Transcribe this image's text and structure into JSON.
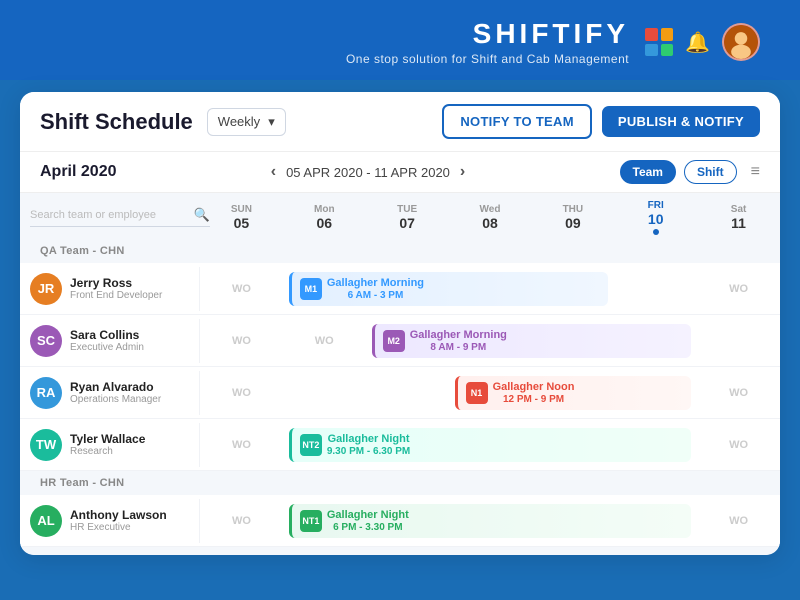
{
  "brand": {
    "title": "SHIFTIFY",
    "subtitle": "One stop solution for Shift and Cab Management"
  },
  "header": {
    "grid_icon": "grid-icon",
    "bell_icon": "🔔",
    "avatar_initials": "👤"
  },
  "schedule": {
    "title": "Shift Schedule",
    "weekly_label": "Weekly",
    "notify_btn": "NOTIFY TO TEAM",
    "publish_btn": "PUBLISH & NOTIFY"
  },
  "nav": {
    "month": "April 2020",
    "date_range": "05 APR  2020 - 11 APR  2020",
    "team_btn": "Team",
    "shift_btn": "Shift",
    "search_placeholder": "Search team or employee"
  },
  "days": [
    {
      "label": "SUN",
      "num": "05",
      "highlight": false
    },
    {
      "label": "Mon",
      "num": "06",
      "highlight": false
    },
    {
      "label": "TUE",
      "num": "07",
      "highlight": false
    },
    {
      "label": "Wed",
      "num": "08",
      "highlight": false
    },
    {
      "label": "THU",
      "num": "09",
      "highlight": false
    },
    {
      "label": "FRI",
      "num": "10",
      "highlight": true
    },
    {
      "label": "Sat",
      "num": "11",
      "highlight": false
    }
  ],
  "teams": [
    {
      "name": "QA Team - CHN",
      "employees": [
        {
          "name": "Jerry Ross",
          "role": "Front End Developer",
          "avatar_color": "#e67e22",
          "initials": "JR",
          "cells": [
            {
              "type": "wo",
              "col": 1
            },
            {
              "type": "shift",
              "col": 2,
              "span": 4,
              "badge": "M1",
              "shift_type": "morning",
              "shift_name": "Gallagher Morning",
              "shift_time": "6 AM - 3 PM"
            },
            {
              "type": "wo",
              "col": 7
            }
          ]
        },
        {
          "name": "Sara Collins",
          "role": "Executive Admin",
          "avatar_color": "#9b59b6",
          "initials": "SC",
          "cells": [
            {
              "type": "wo",
              "col": 1
            },
            {
              "type": "wo",
              "col": 2
            },
            {
              "type": "shift",
              "col": 3,
              "span": 4,
              "badge": "M2",
              "shift_type": "morning2",
              "shift_name": "Gallagher Morning",
              "shift_time": "8 AM - 9 PM"
            }
          ]
        },
        {
          "name": "Ryan Alvarado",
          "role": "Operations Manager",
          "avatar_color": "#3498db",
          "initials": "RA",
          "cells": [
            {
              "type": "wo",
              "col": 1
            },
            {
              "type": "empty",
              "col": 2,
              "span": 2
            },
            {
              "type": "shift",
              "col": 4,
              "span": 3,
              "badge": "N1",
              "shift_type": "noon",
              "shift_name": "Gallagher Noon",
              "shift_time": "12 PM - 9 PM"
            },
            {
              "type": "wo",
              "col": 7
            }
          ]
        },
        {
          "name": "Tyler Wallace",
          "role": "Research",
          "avatar_color": "#1abc9c",
          "initials": "TW",
          "cells": [
            {
              "type": "wo",
              "col": 1
            },
            {
              "type": "shift",
              "col": 2,
              "span": 5,
              "badge": "NT2",
              "shift_type": "night",
              "shift_name": "Gallagher Night",
              "shift_time": "9.30 PM - 6.30 PM"
            },
            {
              "type": "wo",
              "col": 7
            }
          ]
        }
      ]
    },
    {
      "name": "HR Team - CHN",
      "employees": [
        {
          "name": "Anthony Lawson",
          "role": "HR Executive",
          "avatar_color": "#27ae60",
          "initials": "AL",
          "cells": [
            {
              "type": "wo",
              "col": 1
            },
            {
              "type": "shift",
              "col": 2,
              "span": 5,
              "badge": "NT1",
              "shift_type": "night2",
              "shift_name": "Gallagher Night",
              "shift_time": "6 PM - 3.30 PM"
            },
            {
              "type": "wo",
              "col": 7
            }
          ]
        }
      ]
    }
  ]
}
